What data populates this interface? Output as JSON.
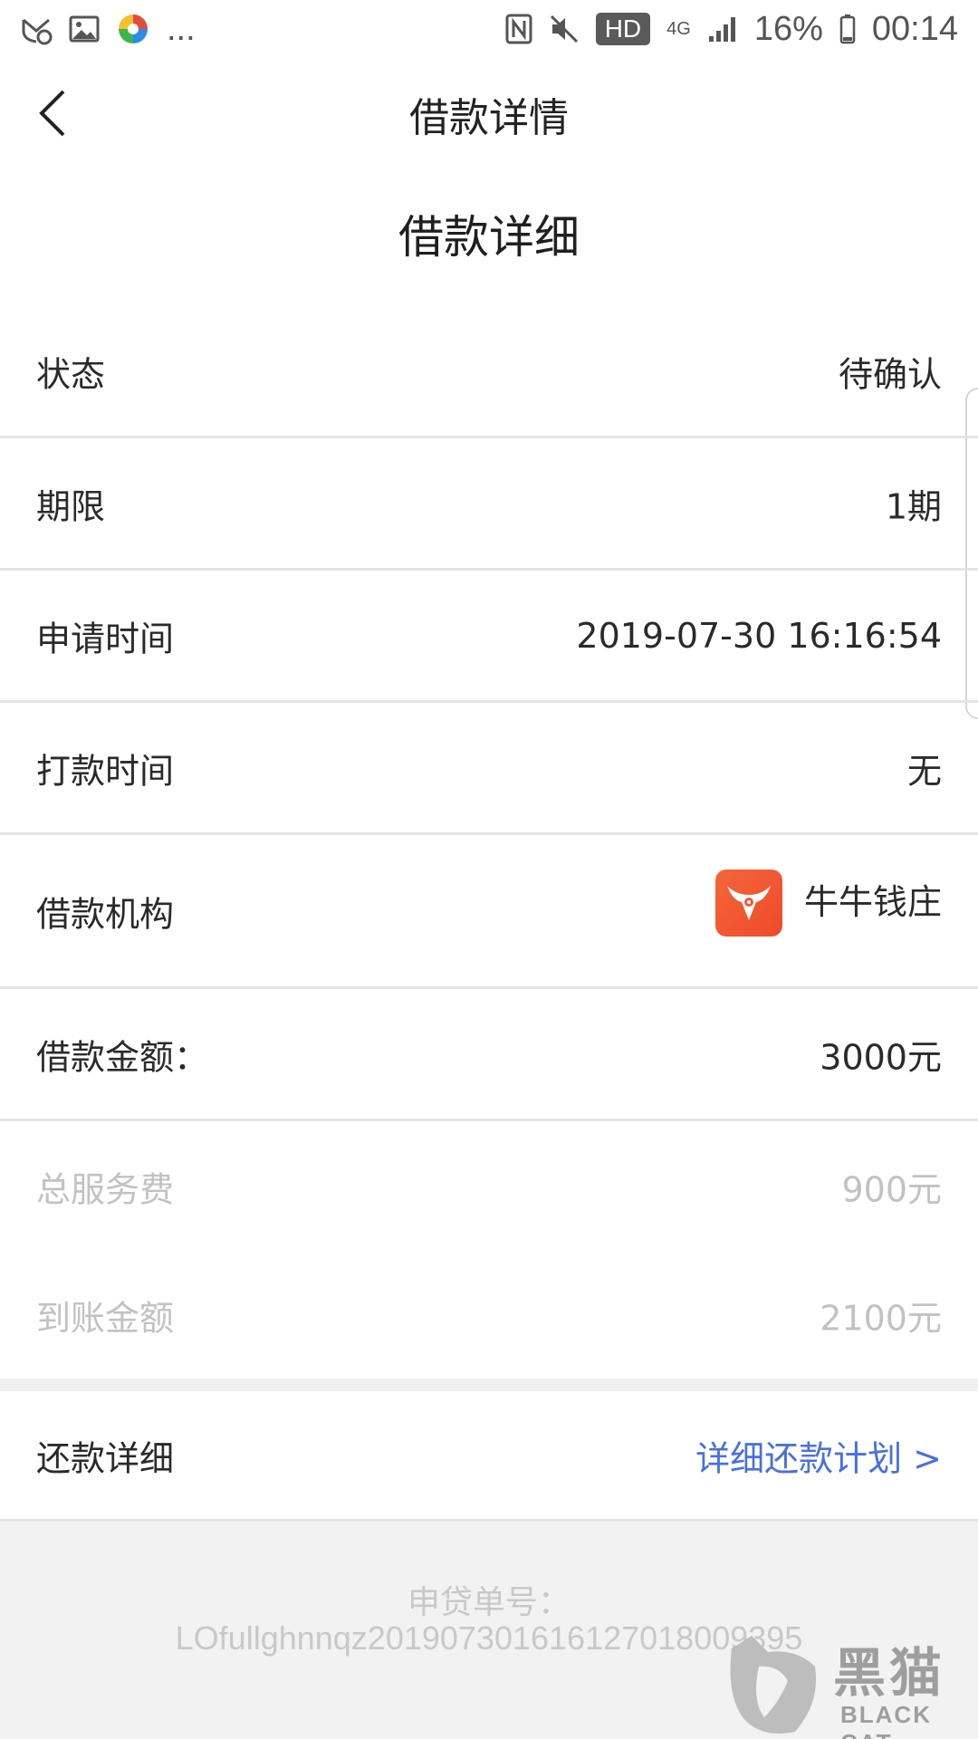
{
  "status_bar": {
    "overflow": "...",
    "network_badge": "HD",
    "network_type": "4G",
    "battery_percent": "16%",
    "time": "00:14"
  },
  "header": {
    "title": "借款详情",
    "back_icon": "chevron-left-icon"
  },
  "section_heading": "借款详细",
  "details": {
    "status": {
      "label": "状态",
      "value": "待确认"
    },
    "term": {
      "label": "期限",
      "value": "1期"
    },
    "apply_time": {
      "label": "申请时间",
      "value": "2019-07-30 16:16:54"
    },
    "payout_time": {
      "label": "打款时间",
      "value": "无"
    },
    "lender": {
      "label": "借款机构",
      "value": "牛牛钱庄",
      "logo_icon": "niuniu-logo-icon",
      "logo_color": "#f05a33"
    },
    "amount": {
      "label": "借款金额：",
      "value": "3000元"
    },
    "service_fee": {
      "label": "总服务费",
      "value": "900元"
    },
    "received": {
      "label": "到账金额",
      "value": "2100元"
    }
  },
  "repayment": {
    "label": "还款详细",
    "link": "详细还款计划 >",
    "link_color": "#4a6fe3"
  },
  "footer": {
    "order_label": "申贷单号：",
    "order_number": "LOfullghnnqz201907301616127018009395"
  },
  "watermark": {
    "cn": "黑猫",
    "en": "BLACK CAT"
  }
}
